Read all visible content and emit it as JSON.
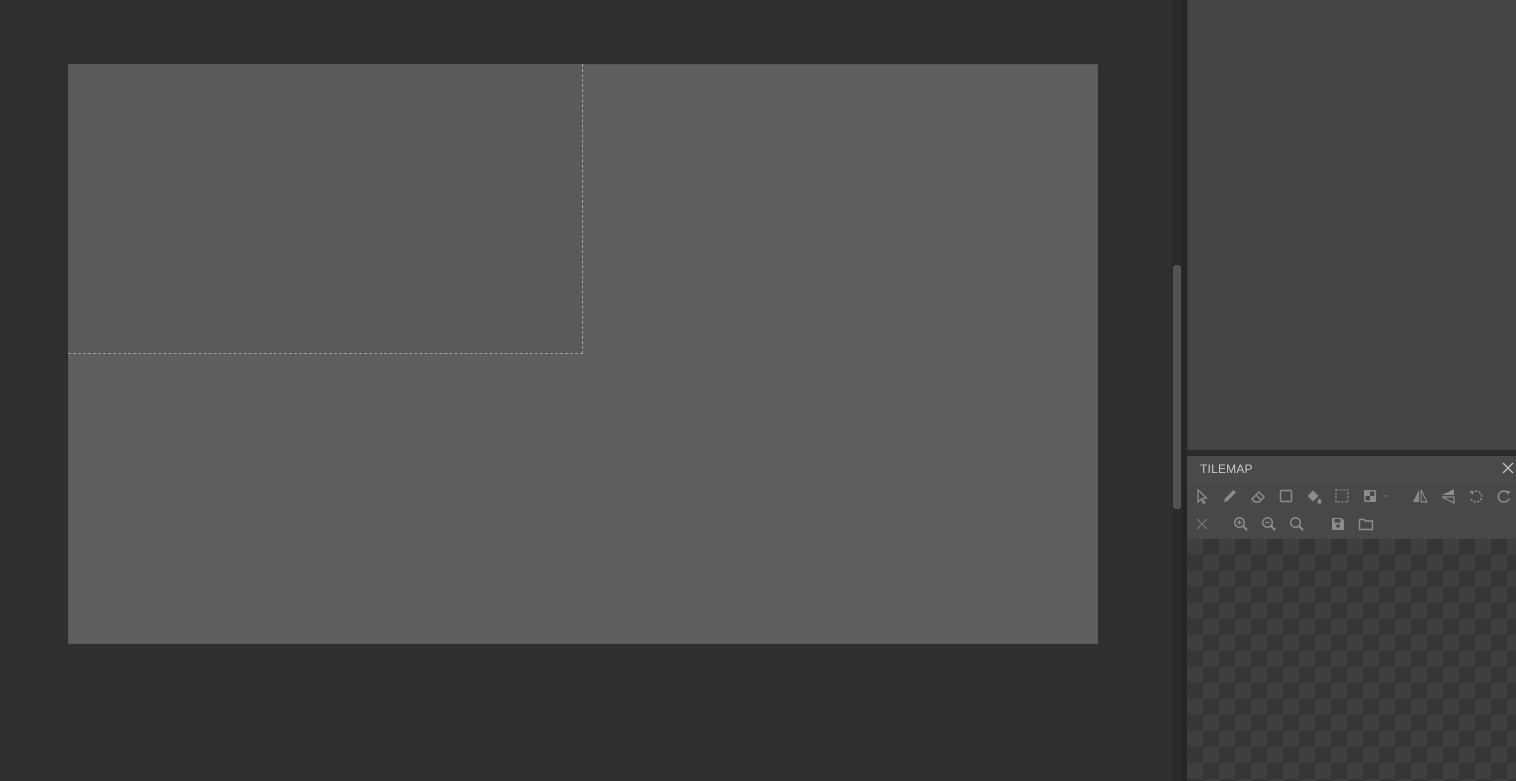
{
  "tilemap_panel": {
    "title": "TILEMAP",
    "close_icon": "close-icon",
    "toolbar_row1": [
      {
        "name": "select-tool",
        "icon": "cursor-icon"
      },
      {
        "name": "pencil-tool",
        "icon": "pencil-icon"
      },
      {
        "name": "eraser-tool",
        "icon": "eraser-icon"
      },
      {
        "name": "rectangle-tool",
        "icon": "rectangle-icon"
      },
      {
        "name": "bucket-fill-tool",
        "icon": "paint-bucket-icon"
      },
      {
        "name": "selection-tool",
        "icon": "dashed-selection-icon"
      },
      {
        "name": "random-tile-tool",
        "icon": "tiles-icon"
      },
      {
        "name": "flip-horizontal",
        "icon": "flip-horizontal-icon"
      },
      {
        "name": "flip-vertical",
        "icon": "flip-vertical-icon"
      },
      {
        "name": "rotate-left",
        "icon": "rotate-left-icon"
      },
      {
        "name": "rotate-right",
        "icon": "rotate-right-icon"
      }
    ],
    "toolbar_row2": [
      {
        "name": "clear",
        "icon": "close-icon"
      },
      {
        "name": "zoom-in",
        "icon": "zoom-in-icon"
      },
      {
        "name": "zoom-out",
        "icon": "zoom-out-icon"
      },
      {
        "name": "zoom-reset",
        "icon": "zoom-reset-icon"
      },
      {
        "name": "save",
        "icon": "save-icon"
      },
      {
        "name": "open-folder",
        "icon": "folder-icon"
      }
    ]
  },
  "colors": {
    "background": "#2f2f2f",
    "canvas": "#5f5f5e",
    "camera_region": "#5a5a5a",
    "dock_panel": "#444444",
    "tilemap_header": "#4a4a4a",
    "icon": "#8c8c8c"
  }
}
